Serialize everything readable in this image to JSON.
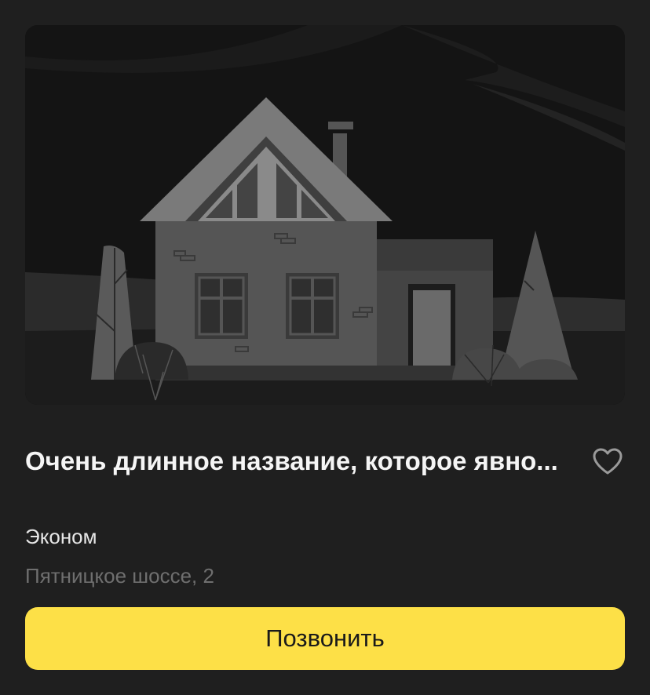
{
  "card": {
    "image": {
      "alt_icon": "house-illustration"
    },
    "title": "Очень длинное название, которое явно...",
    "favorite_icon": "heart-outline-icon",
    "category": "Эконом",
    "address": "Пятницкое шоссе, 2",
    "call_button_label": "Позвонить"
  },
  "colors": {
    "background": "#1f1f1f",
    "image_background": "#141414",
    "accent_button": "#fde047",
    "title_text": "#f5f5f5",
    "secondary_text": "#6f6f6f"
  }
}
